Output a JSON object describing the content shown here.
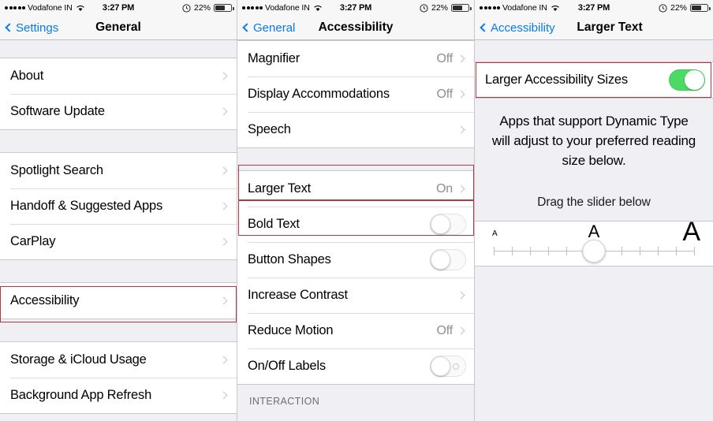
{
  "statusbar": {
    "carrier": "Vodafone IN",
    "time": "3:27 PM",
    "battery_percent": "22%",
    "signal_dots": 5,
    "wifi_icon": "wifi-icon",
    "battery_icon": "battery-icon",
    "alarm_icon": "alarm-icon"
  },
  "colors": {
    "accent_blue": "#0b7ae6",
    "toggle_on_green": "#4cd964",
    "highlight_red": "#b03a48",
    "group_bg": "#efeff4",
    "value_gray": "#8e8e93"
  },
  "panels": [
    {
      "id": "general",
      "nav": {
        "back_label": "Settings",
        "title": "General"
      },
      "groups": [
        {
          "rows": [
            {
              "label": "About",
              "value": "",
              "accessory": "chevron"
            },
            {
              "label": "Software Update",
              "value": "",
              "accessory": "chevron"
            }
          ]
        },
        {
          "rows": [
            {
              "label": "Spotlight Search",
              "value": "",
              "accessory": "chevron"
            },
            {
              "label": "Handoff & Suggested Apps",
              "value": "",
              "accessory": "chevron"
            },
            {
              "label": "CarPlay",
              "value": "",
              "accessory": "chevron"
            }
          ]
        },
        {
          "highlighted": true,
          "rows": [
            {
              "label": "Accessibility",
              "value": "",
              "accessory": "chevron"
            }
          ]
        },
        {
          "rows": [
            {
              "label": "Storage & iCloud Usage",
              "value": "",
              "accessory": "chevron"
            },
            {
              "label": "Background App Refresh",
              "value": "",
              "accessory": "chevron"
            }
          ]
        }
      ]
    },
    {
      "id": "accessibility",
      "nav": {
        "back_label": "General",
        "title": "Accessibility"
      },
      "groups": [
        {
          "rows": [
            {
              "label": "Magnifier",
              "value": "Off",
              "accessory": "chevron"
            },
            {
              "label": "Display Accommodations",
              "value": "Off",
              "accessory": "chevron"
            },
            {
              "label": "Speech",
              "value": "",
              "accessory": "chevron"
            }
          ]
        },
        {
          "rows": [
            {
              "label": "Larger Text",
              "value": "On",
              "accessory": "chevron",
              "highlighted": true
            },
            {
              "label": "Bold Text",
              "value": "",
              "accessory": "toggle",
              "toggle_on": false,
              "highlighted": true
            },
            {
              "label": "Button Shapes",
              "value": "",
              "accessory": "toggle",
              "toggle_on": false
            },
            {
              "label": "Increase Contrast",
              "value": "",
              "accessory": "chevron"
            },
            {
              "label": "Reduce Motion",
              "value": "Off",
              "accessory": "chevron"
            },
            {
              "label": "On/Off Labels",
              "value": "",
              "accessory": "toggle-olabel",
              "toggle_on": false
            }
          ]
        }
      ],
      "section_footer": "INTERACTION"
    },
    {
      "id": "larger-text",
      "nav": {
        "back_label": "Accessibility",
        "title": "Larger Text"
      },
      "toggle_row": {
        "label": "Larger Accessibility Sizes",
        "toggle_on": true,
        "highlighted": true
      },
      "description": "Apps that support Dynamic Type will adjust to your preferred reading size below.",
      "drag_note": "Drag the slider below",
      "slider": {
        "min_label": "A",
        "mid_label": "A",
        "max_label": "A",
        "tick_count": 12,
        "value_index": 6
      }
    }
  ]
}
